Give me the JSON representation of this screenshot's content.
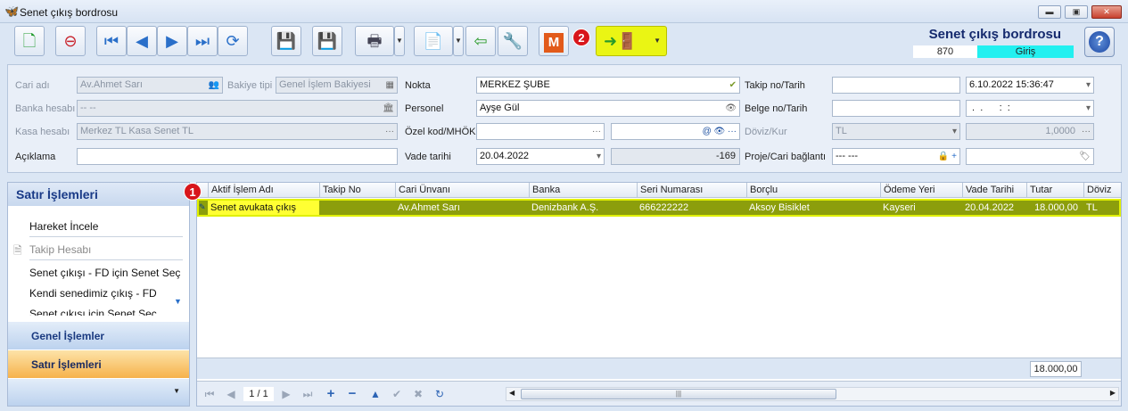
{
  "window": {
    "title": "Senet çıkış bordrosu",
    "min": "▬",
    "max": "▣",
    "close": "✕"
  },
  "header": {
    "title": "Senet çıkış bordrosu",
    "number": "870",
    "status": "Giriş"
  },
  "toolbar": {
    "m_label": "M",
    "badge2": "2"
  },
  "form": {
    "cari_adi_label": "Cari adı",
    "cari_adi": "Av.Ahmet Sarı",
    "bakiye_tipi_label": "Bakiye tipi",
    "bakiye_tipi": "Genel İşlem Bakiyesi",
    "banka_hesabi_label": "Banka hesabı",
    "banka_hesabi": "-- --",
    "kasa_hesabi_label": "Kasa hesabı",
    "kasa_hesabi": "Merkez TL Kasa Senet TL",
    "aciklama_label": "Açıklama",
    "aciklama": "",
    "nokta_label": "Nokta",
    "nokta": "MERKEZ ŞUBE",
    "personel_label": "Personel",
    "personel": "Ayşe Gül",
    "ozel_kod_label": "Özel kod/MHÖK",
    "ozel_kod": "",
    "vade_label": "Vade tarihi",
    "vade": "20.04.2022",
    "vade_days": "-169",
    "takip_label": "Takip no/Tarih",
    "takip_no": "",
    "takip_tarih": "6.10.2022 15:36:47",
    "belge_label": "Belge no/Tarih",
    "belge_no": "",
    "belge_tarih": " .  .      :  :",
    "doviz_label": "Döviz/Kur",
    "doviz": "TL",
    "kur": "1,0000",
    "proje_label": "Proje/Cari bağlantı",
    "proje": "--- ---",
    "proje2": ""
  },
  "left_panel": {
    "title": "Satır İşlemleri",
    "items": [
      "Hareket İncele",
      "Takip Hesabı",
      "Senet çıkışı - FD için Senet Seç",
      "Kendi senedimiz çıkış - FD",
      "Senet çıkışı için Senet Seç"
    ],
    "nav": [
      "Genel İşlemler",
      "Satır İşlemleri"
    ]
  },
  "grid": {
    "columns": [
      "Aktif İşlem Adı",
      "Takip No",
      "Cari Ünvanı",
      "Banka",
      "Seri Numarası",
      "Borçlu",
      "Ödeme Yeri",
      "Vade Tarihi",
      "Tutar",
      "Döviz"
    ],
    "rows": [
      [
        "Senet avukata çıkış",
        "",
        "Av.Ahmet Sarı",
        "Denizbank A.Ş.",
        "666222222",
        "Aksoy Bisiklet",
        "Kayseri",
        "20.04.2022",
        "18.000,00",
        "TL"
      ]
    ],
    "total": "18.000,00",
    "pager": "1 / 1",
    "badge1": "1"
  }
}
